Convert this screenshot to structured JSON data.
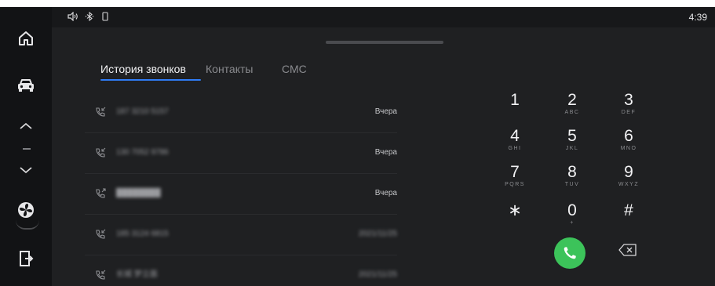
{
  "status_bar": {
    "volume_icon": "speaker-volume-icon",
    "bluetooth_icon": "bluetooth-icon",
    "phone_icon": "phone-outline-icon",
    "time": "4:39"
  },
  "sidebar": {
    "items": [
      {
        "icon": "home-icon"
      },
      {
        "icon": "car-icon"
      },
      {
        "icon": "chevron-up-icon"
      },
      {
        "icon": "chevron-down-icon"
      },
      {
        "icon": "fan-icon"
      },
      {
        "icon": "exit-icon"
      }
    ],
    "temperature_placeholder": "- -"
  },
  "tabs": [
    {
      "label": "История звонков",
      "active": true
    },
    {
      "label": "Контакты",
      "active": false
    },
    {
      "label": "СМС",
      "active": false
    }
  ],
  "calls": [
    {
      "number": "187 3210 5157",
      "date": "Вчера",
      "direction": "incoming"
    },
    {
      "number": "130 7052 9786",
      "date": "Вчера",
      "direction": "incoming"
    },
    {
      "number": "████████",
      "date": "Вчера",
      "direction": "outgoing"
    },
    {
      "number": "185 3124 6815",
      "date": "2021/11/25",
      "direction": "incoming"
    },
    {
      "number": "长城 梦立面",
      "date": "2021/11/25",
      "direction": "incoming"
    }
  ],
  "dialpad": {
    "keys": [
      {
        "digit": "1",
        "letters": ""
      },
      {
        "digit": "2",
        "letters": "ABC"
      },
      {
        "digit": "3",
        "letters": "DEF"
      },
      {
        "digit": "4",
        "letters": "GHI"
      },
      {
        "digit": "5",
        "letters": "JKL"
      },
      {
        "digit": "6",
        "letters": "MNO"
      },
      {
        "digit": "7",
        "letters": "PQRS"
      },
      {
        "digit": "8",
        "letters": "TUV"
      },
      {
        "digit": "9",
        "letters": "WXYZ"
      },
      {
        "digit": "∗",
        "letters": ""
      },
      {
        "digit": "0",
        "letters": "+"
      },
      {
        "digit": "#",
        "letters": ""
      }
    ]
  },
  "colors": {
    "accent": "#2f7cf6",
    "call_button": "#3cc35a",
    "background": "#1f2022"
  }
}
